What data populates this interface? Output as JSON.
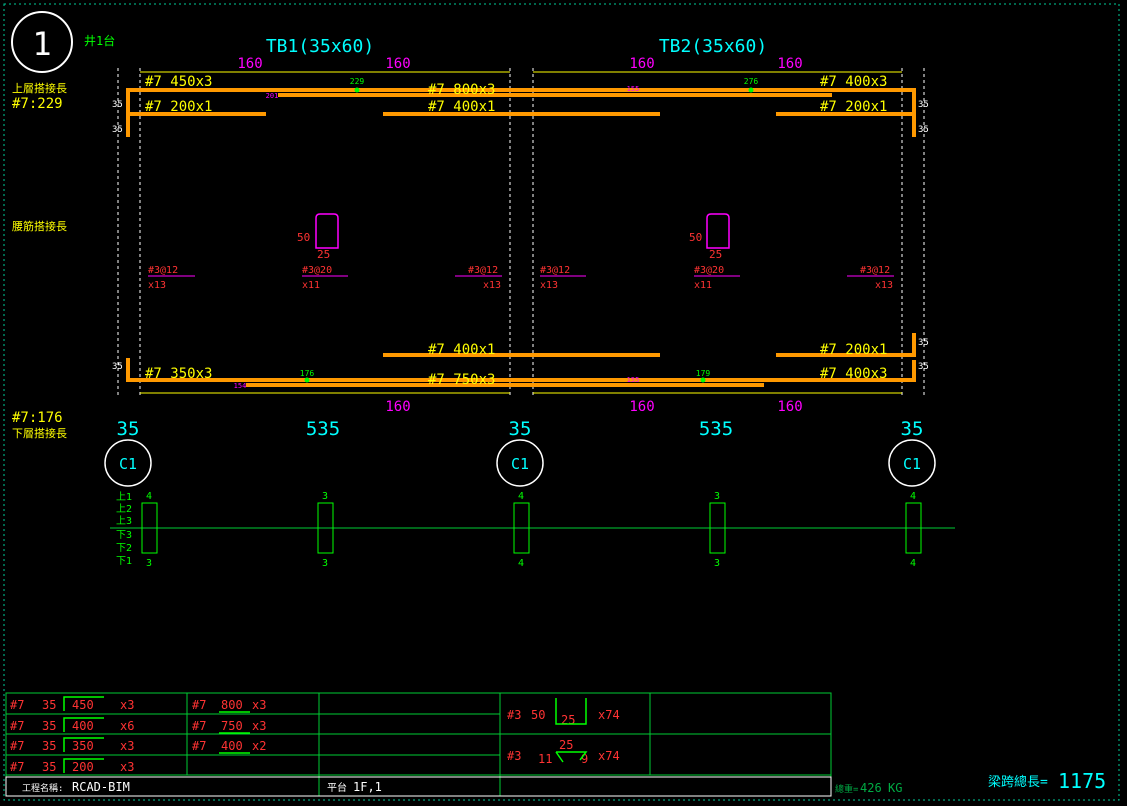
{
  "header": {
    "circle_number": "1",
    "sheet_label": "井1台"
  },
  "side_labels": {
    "top_lap_title": "上層搭接長",
    "top_lap_value": "#7:229",
    "web_lap_title": "腰筋搭接長",
    "bottom_lap_value": "#7:176",
    "bottom_lap_title": "下層搭接長"
  },
  "beams": [
    {
      "title": "TB1(35x60)",
      "top_dims": [
        "160",
        "160"
      ],
      "bottom_dims": [
        "160"
      ],
      "top_bars": [
        "#7 450x3",
        "#7 800x3",
        "#7 200x1",
        "#7 400x1"
      ],
      "bottom_bars": [
        "#7 400x1",
        "#7 350x3",
        "#7 750x3"
      ],
      "marks": [
        "229",
        "201",
        "176",
        "154"
      ],
      "stirrup": {
        "height": "50",
        "width": "25"
      },
      "stirrup_spacing": [
        {
          "spec": "#3@12",
          "count": "x13"
        },
        {
          "spec": "#3@20",
          "count": "x11"
        },
        {
          "spec": "#3@12",
          "count": "x13"
        }
      ]
    },
    {
      "title": "TB2(35x60)",
      "top_dims": [
        "160",
        "160"
      ],
      "bottom_dims": [
        "160",
        "160"
      ],
      "top_bars": [
        "#7 400x3",
        "#7 200x1"
      ],
      "bottom_bars": [
        "#7 200x1",
        "#7 400x3"
      ],
      "marks": [
        "155",
        "276",
        "155",
        "179"
      ],
      "stirrup": {
        "height": "50",
        "width": "25"
      },
      "stirrup_spacing": [
        {
          "spec": "#3@12",
          "count": "x13"
        },
        {
          "spec": "#3@20",
          "count": "x11"
        },
        {
          "spec": "#3@12",
          "count": "x13"
        }
      ]
    }
  ],
  "end_marks": [
    "35",
    "35",
    "35",
    "35",
    "35",
    "35",
    "35",
    "35"
  ],
  "spans": [
    "35",
    "535",
    "35",
    "535",
    "35"
  ],
  "columns": [
    "C1",
    "C1",
    "C1"
  ],
  "layer_labels": [
    "上1",
    "上2",
    "上3",
    "下3",
    "下2",
    "下1"
  ],
  "section_counts": [
    {
      "top": "4",
      "bottom": "3"
    },
    {
      "top": "3",
      "bottom": "3"
    },
    {
      "top": "4",
      "bottom": "4"
    },
    {
      "top": "3",
      "bottom": "3"
    },
    {
      "top": "4",
      "bottom": "4"
    }
  ],
  "bar_schedule": [
    {
      "bar": "#7",
      "hook": "35",
      "length": "450",
      "qty": "x3"
    },
    {
      "bar": "#7",
      "hook": "35",
      "length": "400",
      "qty": "x6"
    },
    {
      "bar": "#7",
      "hook": "35",
      "length": "350",
      "qty": "x3"
    },
    {
      "bar": "#7",
      "hook": "35",
      "length": "200",
      "qty": "x3"
    },
    {
      "bar": "#7",
      "length": "800",
      "qty": "x3"
    },
    {
      "bar": "#7",
      "length": "750",
      "qty": "x3"
    },
    {
      "bar": "#7",
      "length": "400",
      "qty": "x2"
    }
  ],
  "stirrup_schedule": [
    {
      "bar": "#3",
      "height": "50",
      "width": "25",
      "qty": "x74"
    },
    {
      "bar": "#3",
      "side": "11",
      "width": "25",
      "hook": "9",
      "qty": "x74"
    }
  ],
  "footer": {
    "project_label": "工程名稱:",
    "project_name": "RCAD-BIM",
    "level_label": "平台",
    "level_value": "1F,1",
    "weight_label": "總重=",
    "weight_value": "426",
    "weight_unit": "KG",
    "total_length_label": "梁跨總長=",
    "total_length_value": "1175"
  },
  "colors": {
    "background": "#000000",
    "rebar": "#ff9900",
    "text_yellow": "#ffff00",
    "title_cyan": "#00ffff",
    "dim_magenta": "#ff00ff",
    "mark_green": "#00ff00",
    "spacing_red": "#ff3333",
    "frame_green": "#00cc66"
  }
}
